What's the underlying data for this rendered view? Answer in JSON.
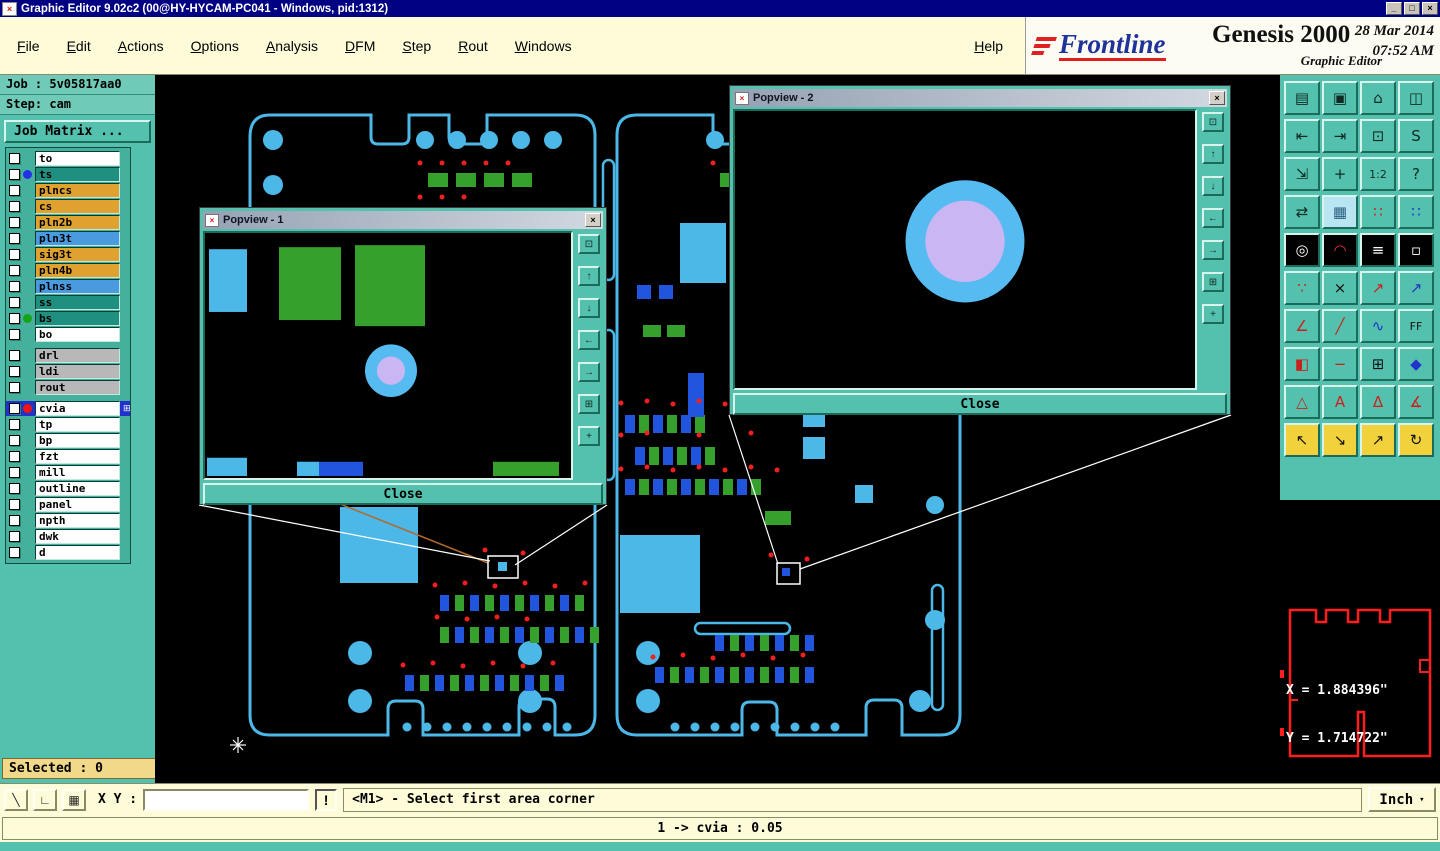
{
  "window": {
    "title": "Graphic Editor 9.02c2 (00@HY-HYCAM-PC041 - Windows, pid:1312)",
    "app_icon_glyph": "×",
    "minimize_glyph": "_",
    "maximize_glyph": "□",
    "close_glyph": "×"
  },
  "menu": {
    "items": [
      {
        "name": "menu-file",
        "label": "File"
      },
      {
        "name": "menu-edit",
        "label": "Edit"
      },
      {
        "name": "menu-actions",
        "label": "Actions"
      },
      {
        "name": "menu-options",
        "label": "Options"
      },
      {
        "name": "menu-analysis",
        "label": "Analysis"
      },
      {
        "name": "menu-dfm",
        "label": "DFM"
      },
      {
        "name": "menu-step",
        "label": "Step"
      },
      {
        "name": "menu-rout",
        "label": "Rout"
      },
      {
        "name": "menu-windows",
        "label": "Windows"
      }
    ],
    "help": "Help"
  },
  "branding": {
    "logo": "Frontline",
    "product": "Genesis 2000",
    "subtitle": "Graphic Editor",
    "date": "28 Mar 2014",
    "time": "07:52 AM"
  },
  "sidebar": {
    "job": "Job : 5v05817aa0",
    "step": "Step: cam",
    "job_matrix": "Job Matrix ...",
    "selected": "Selected : 0",
    "layers_top": [
      {
        "name": "to",
        "bg": "#ffffff"
      },
      {
        "name": "ts",
        "bg": "#1f9080",
        "dot": "#2230e8"
      },
      {
        "name": "plncs",
        "bg": "#dfa22f"
      },
      {
        "name": "cs",
        "bg": "#dfa22f"
      },
      {
        "name": "pln2b",
        "bg": "#dfa22f"
      },
      {
        "name": "pln3t",
        "bg": "#4a9ae0"
      },
      {
        "name": "sig3t",
        "bg": "#dfa22f"
      },
      {
        "name": "pln4b",
        "bg": "#dfa22f"
      },
      {
        "name": "plnss",
        "bg": "#4a9ae0"
      },
      {
        "name": "ss",
        "bg": "#1f9080"
      },
      {
        "name": "bs",
        "bg": "#1f9080",
        "dot": "#17a317"
      },
      {
        "name": "bo",
        "bg": "#ffffff"
      }
    ],
    "layers_mid": [
      {
        "name": "drl",
        "bg": "#b8b8b8"
      },
      {
        "name": "ldi",
        "bg": "#b8b8b8"
      },
      {
        "name": "rout",
        "bg": "#b8b8b8"
      }
    ],
    "layers_bottom": [
      {
        "name": "cvia",
        "bg": "#ffffff",
        "dot": "#ee1414",
        "active": "active",
        "marker": "⊞"
      },
      {
        "name": "tp",
        "bg": "#ffffff"
      },
      {
        "name": "bp",
        "bg": "#ffffff"
      },
      {
        "name": "fzt",
        "bg": "#ffffff"
      },
      {
        "name": "mill",
        "bg": "#ffffff"
      },
      {
        "name": "outline",
        "bg": "#ffffff"
      },
      {
        "name": "panel",
        "bg": "#ffffff"
      },
      {
        "name": "npth",
        "bg": "#ffffff"
      },
      {
        "name": "dwk",
        "bg": "#ffffff"
      },
      {
        "name": "d",
        "bg": "#ffffff"
      }
    ]
  },
  "popviews": {
    "icon_glyph": "×",
    "close_x": "×",
    "close": "Close",
    "one": {
      "title": "Popview - 1"
    },
    "two": {
      "title": "Popview - 2"
    },
    "buttons": [
      {
        "name": "popview-window-button",
        "glyph": "⊡"
      },
      {
        "name": "popview-pan-up-button",
        "glyph": "↑"
      },
      {
        "name": "popview-pan-down-button",
        "glyph": "↓"
      },
      {
        "name": "popview-pan-left-button",
        "glyph": "←"
      },
      {
        "name": "popview-pan-right-button",
        "glyph": "→"
      },
      {
        "name": "popview-zoom-button",
        "glyph": "⊞"
      },
      {
        "name": "popview-move-button",
        "glyph": "+"
      }
    ]
  },
  "right_toolbar": {
    "buttons": [
      {
        "name": "new-window-button",
        "glyph": "▤"
      },
      {
        "name": "screen-view-button",
        "glyph": "▣"
      },
      {
        "name": "home-view-button",
        "glyph": "⌂"
      },
      {
        "name": "tile-view-button",
        "glyph": "◫"
      },
      {
        "name": "zoom-prev-button",
        "glyph": "⇤"
      },
      {
        "name": "zoom-next-button",
        "glyph": "⇥"
      },
      {
        "name": "view-window-button",
        "glyph": "⊡"
      },
      {
        "name": "s-view-button",
        "glyph": "S"
      },
      {
        "name": "zoom-fit-button",
        "glyph": "⇲"
      },
      {
        "name": "zoom-center-button",
        "glyph": "+"
      },
      {
        "name": "zoom-ratio-button",
        "glyph": "1:2",
        "fs": "11px"
      },
      {
        "name": "help-button",
        "glyph": "?"
      },
      {
        "name": "layers-swap-button",
        "glyph": "⇄"
      },
      {
        "name": "grid-button",
        "glyph": "▦",
        "bg": "#b9e4f2",
        "fg": "#2a6080"
      },
      {
        "name": "snap-red-button",
        "glyph": "∷",
        "fg": "#cc1f1f"
      },
      {
        "name": "snap-blue-button",
        "glyph": "∷",
        "fg": "#2233cc"
      },
      {
        "name": "target-button",
        "glyph": "◎",
        "bg": "#000000",
        "fg": "#ffffff"
      },
      {
        "name": "arc-probe-button",
        "glyph": "◠",
        "bg": "#000000",
        "fg": "#ee3333"
      },
      {
        "name": "ruler-button",
        "glyph": "≡",
        "bg": "#000000",
        "fg": "#ffffff"
      },
      {
        "name": "dotted-region-button",
        "glyph": "▫",
        "bg": "#000000",
        "fg": "#ffffff"
      },
      {
        "name": "net-points-button",
        "glyph": "∵",
        "fg": "#cc1f1f"
      },
      {
        "name": "delete-x-button",
        "glyph": "×",
        "fg": "#111111"
      },
      {
        "name": "vector-red-button",
        "glyph": "↗",
        "fg": "#cc1f1f"
      },
      {
        "name": "vector-blue-button",
        "glyph": "↗",
        "fg": "#2233cc"
      },
      {
        "name": "angle-tool-button",
        "glyph": "∠",
        "fg": "#cc1f1f"
      },
      {
        "name": "line-tool-button",
        "glyph": "╱",
        "fg": "#cc1f1f"
      },
      {
        "name": "wave-tool-button",
        "glyph": "∿",
        "fg": "#2233cc"
      },
      {
        "name": "flip-button",
        "glyph": "FF",
        "fs": "11px",
        "fg": "#111111"
      },
      {
        "name": "half-fill-button",
        "glyph": "◧",
        "fg": "#cc1f1f"
      },
      {
        "name": "dash-tool-button",
        "glyph": "−",
        "fg": "#cc1f1f"
      },
      {
        "name": "transform-button",
        "glyph": "⊞",
        "fg": "#111111"
      },
      {
        "name": "shape-tool-button",
        "glyph": "◆",
        "fg": "#2233cc"
      },
      {
        "name": "triangle-outline-button",
        "glyph": "△",
        "fg": "#cc1f1f"
      },
      {
        "name": "triangle-a-button",
        "glyph": "A",
        "fg": "#cc1f1f"
      },
      {
        "name": "triangle-delta-button",
        "glyph": "Δ",
        "fg": "#cc1f1f"
      },
      {
        "name": "angle-arc-button",
        "glyph": "∡",
        "fg": "#cc1f1f"
      },
      {
        "name": "cursor-nw-button",
        "glyph": "↖",
        "bg": "#f2d23c",
        "fg": "#111111"
      },
      {
        "name": "cursor-se-button",
        "glyph": "↘",
        "bg": "#f2d23c",
        "fg": "#111111"
      },
      {
        "name": "cursor-ne-button",
        "glyph": "↗",
        "bg": "#f2d23c",
        "fg": "#111111"
      },
      {
        "name": "cursor-rotate-button",
        "glyph": "↻",
        "bg": "#f2d23c",
        "fg": "#111111"
      }
    ]
  },
  "readout": {
    "x": "X = 1.884396\"",
    "y": "Y = 1.714722\""
  },
  "statusbar": {
    "tools": [
      {
        "name": "snap-line-button",
        "glyph": "╲"
      },
      {
        "name": "snap-angle-button",
        "glyph": "∟"
      },
      {
        "name": "grid-toggle-button",
        "glyph": "▦"
      }
    ],
    "xy_label": "X Y :",
    "input_value": "",
    "alert": "!",
    "message": "<M1> - Select first area corner",
    "units": "Inch",
    "units_arrow": "▾"
  },
  "footer": {
    "text": "1 -> cvia : 0.05"
  }
}
